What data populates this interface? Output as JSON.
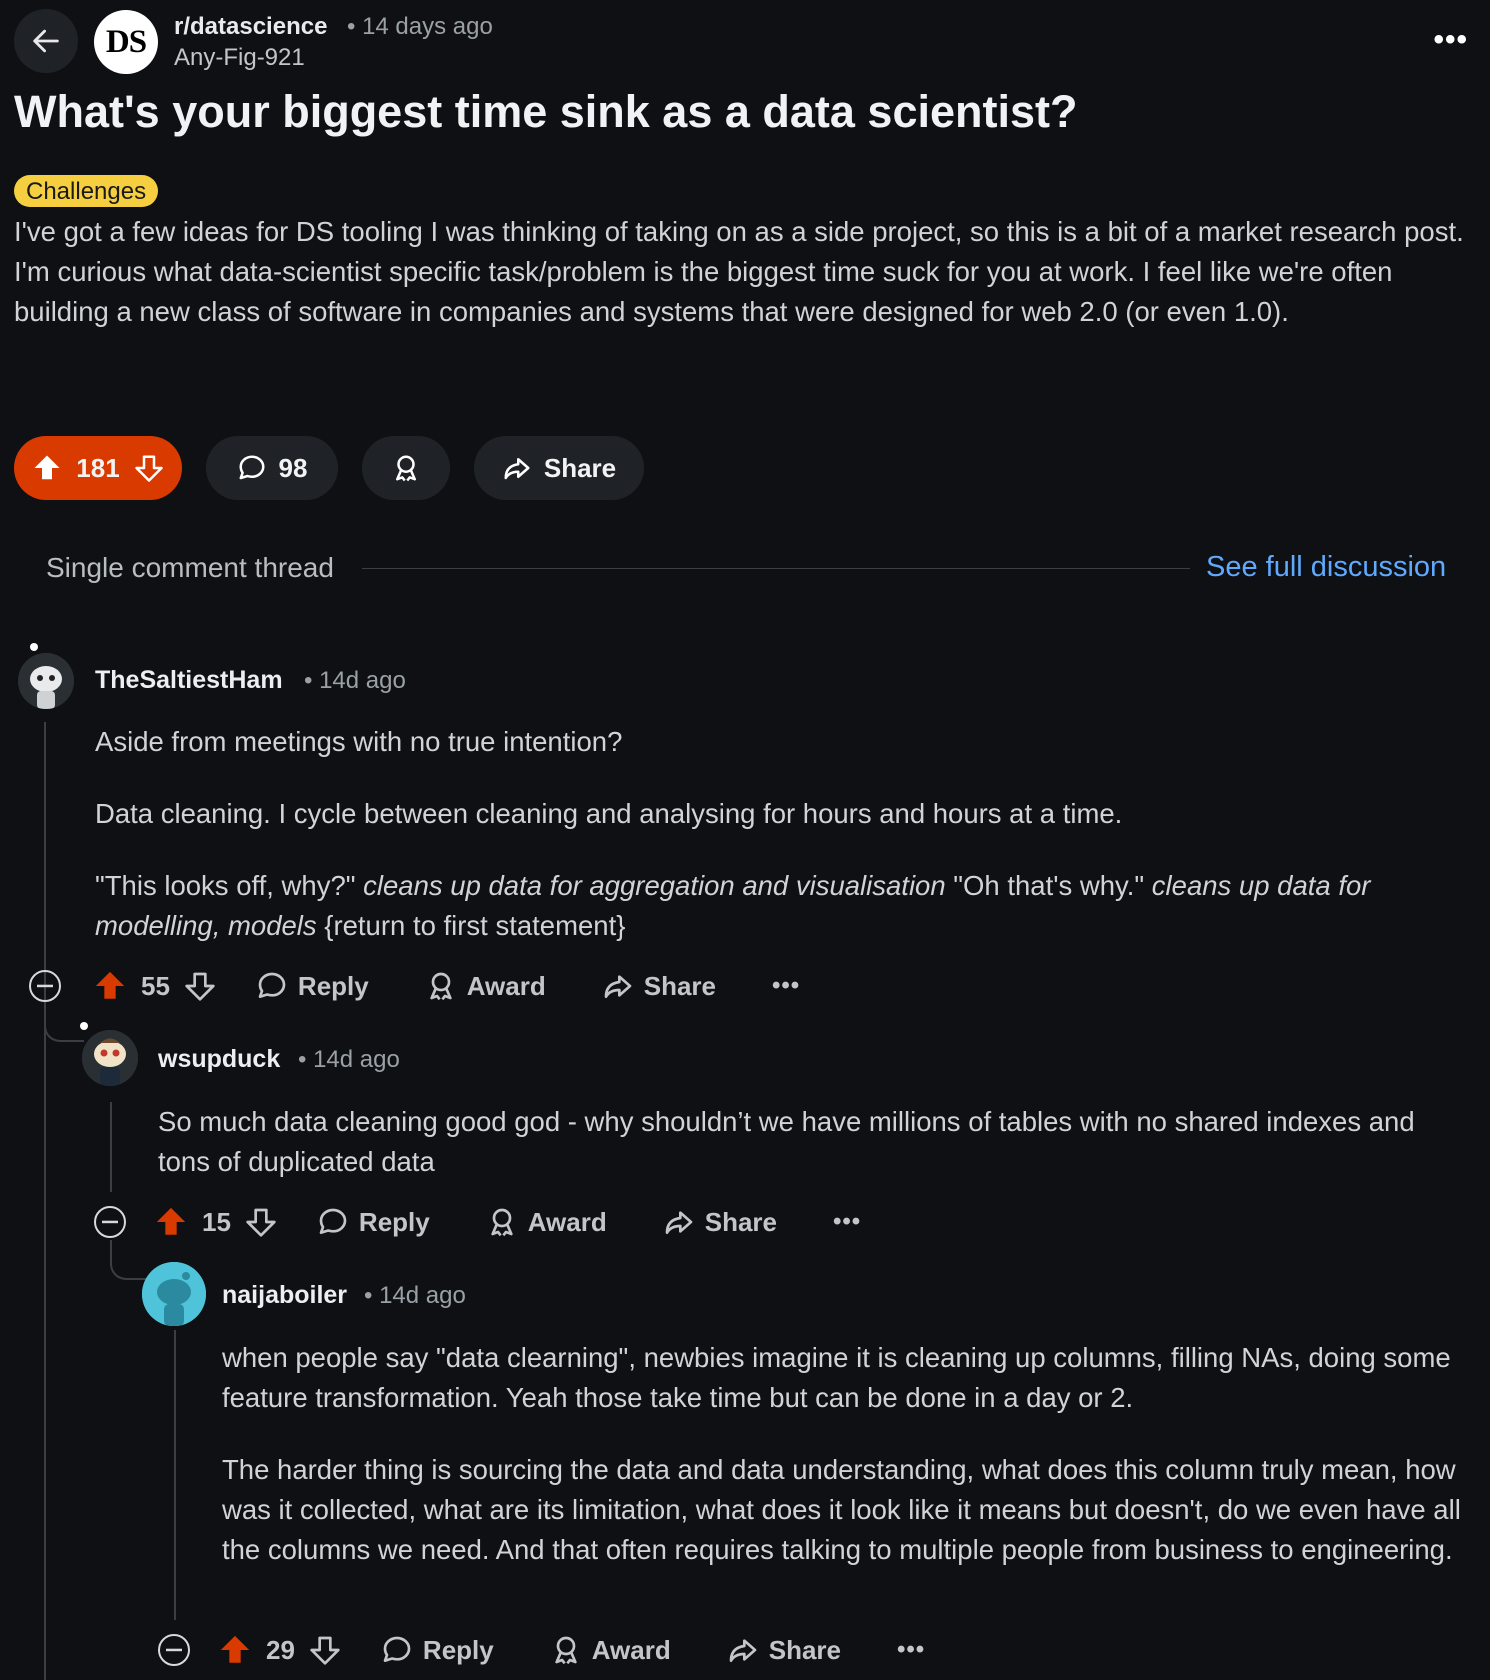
{
  "header": {
    "subreddit": "r/datascience",
    "subreddit_icon_text": "DS",
    "time": "• 14 days ago",
    "author": "Any-Fig-921",
    "more": "•••"
  },
  "post": {
    "title": "What's your biggest time sink as a data scientist?",
    "flair": "Challenges",
    "body": "I've got a few ideas for DS tooling I was thinking of taking on as a side project, so this is a bit of a market research post. I'm curious what data-scientist specific task/problem is the biggest time suck for you at work. I feel like we're often building a new class of software in companies and systems that were designed for web 2.0 (or even 1.0).",
    "score": "181",
    "comments": "98",
    "share": "Share"
  },
  "thread": {
    "label": "Single comment thread",
    "full_discussion": "See full discussion"
  },
  "labels": {
    "reply": "Reply",
    "award": "Award",
    "share": "Share",
    "more": "•••"
  },
  "comments": [
    {
      "user": "TheSaltiestHam",
      "time": "• 14d ago",
      "p1": "Aside from meetings with no true intention?",
      "p2": "Data cleaning. I cycle between cleaning and analysing for hours and hours at a time.",
      "p3_a": "\"This looks off, why?\" ",
      "p3_b": "cleans up data for aggregation and visualisation",
      "p3_c": " \"Oh that's why.\" ",
      "p3_d": "cleans up data for modelling, models",
      "p3_e": " {return to first statement}",
      "score": "55"
    },
    {
      "user": "wsupduck",
      "time": "• 14d ago",
      "p1": "So much data cleaning good god - why shouldn’t we have millions of tables with no shared indexes and tons of duplicated data",
      "score": "15"
    },
    {
      "user": "naijaboiler",
      "time": "• 14d ago",
      "p1": "when people say \"data clearning\", newbies imagine it is cleaning up columns, filling NAs, doing some feature transformation. Yeah those take time but can be done in a day or 2.",
      "p2": "The harder thing is sourcing the data and data understanding, what does this column truly mean, how was it collected, what are its limitation, what does it look like it means but doesn't, do we even have all the columns we need. And that often requires talking to multiple people from business to engineering.",
      "score": "29"
    }
  ],
  "colors": {
    "background": "#0e1013",
    "upvote": "#d93a00",
    "link": "#5fa9ff",
    "flair": "#f5cf40"
  }
}
